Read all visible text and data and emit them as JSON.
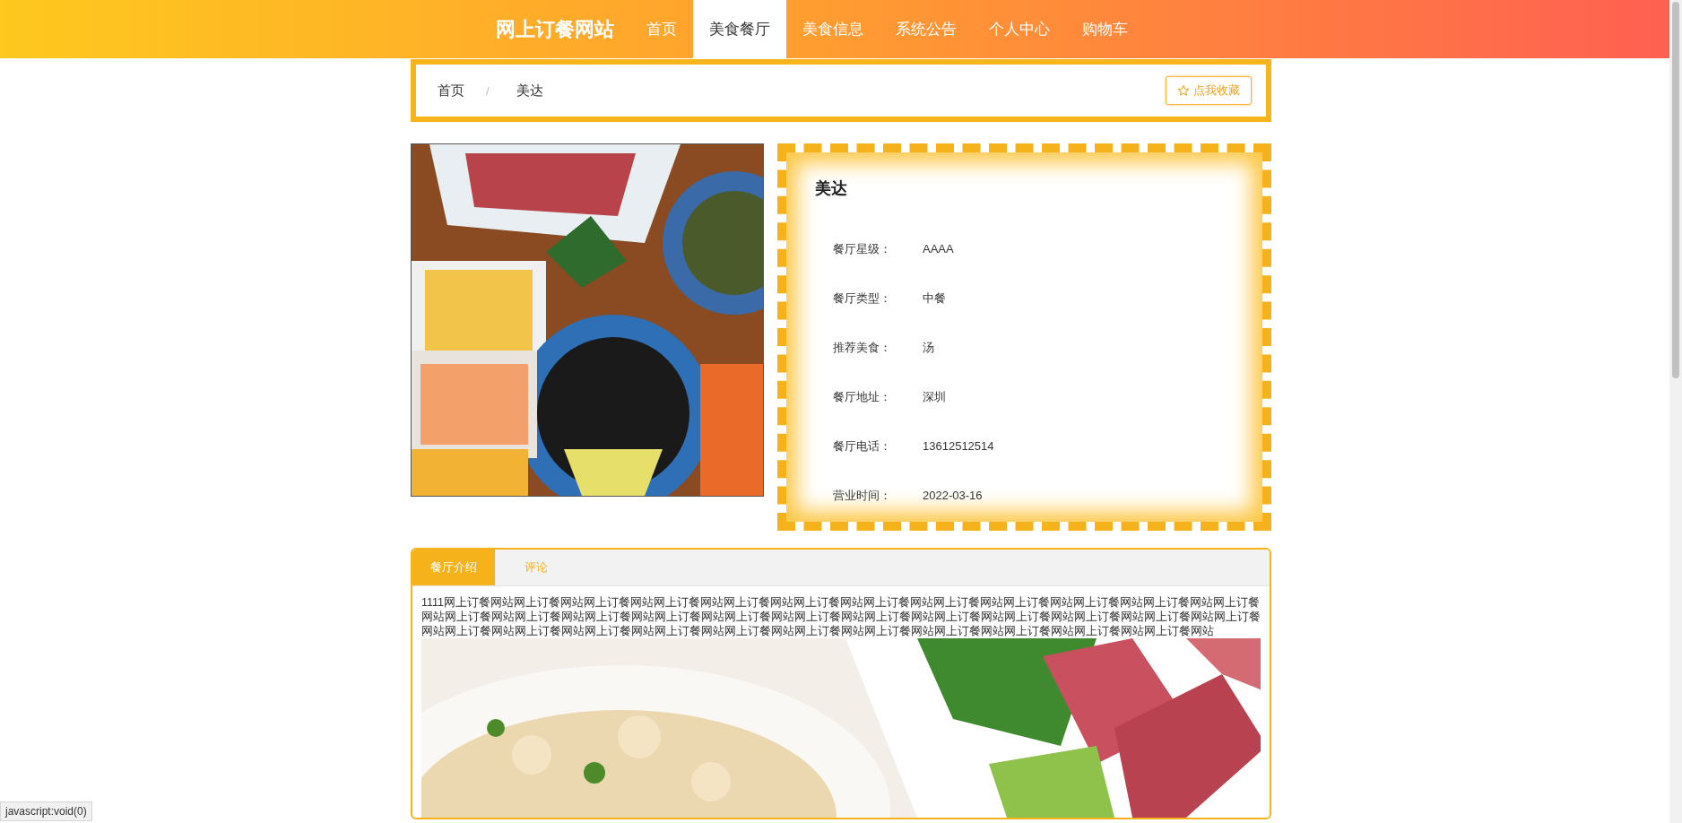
{
  "nav": {
    "brand": "网上订餐网站",
    "items": [
      {
        "label": "首页",
        "selected": false
      },
      {
        "label": "美食餐厅",
        "selected": true
      },
      {
        "label": "美食信息",
        "selected": false
      },
      {
        "label": "系统公告",
        "selected": false
      },
      {
        "label": "个人中心",
        "selected": false
      },
      {
        "label": "购物车",
        "selected": false
      }
    ]
  },
  "breadcrumb": [
    {
      "label": "首页"
    },
    {
      "label": "美达"
    }
  ],
  "breadcrumb_separator": "/",
  "favorite_button": "点我收藏",
  "restaurant": {
    "name": "美达",
    "fields": [
      {
        "label": "餐厅星级：",
        "value": "AAAA"
      },
      {
        "label": "餐厅类型：",
        "value": "中餐"
      },
      {
        "label": "推荐美食：",
        "value": "汤"
      },
      {
        "label": "餐厅地址：",
        "value": "深圳"
      },
      {
        "label": "餐厅电话：",
        "value": "13612512514"
      },
      {
        "label": "营业时间：",
        "value": "2022-03-16"
      }
    ]
  },
  "tabs": [
    {
      "label": "餐厅介绍",
      "selected": true
    },
    {
      "label": "评论",
      "selected": false
    }
  ],
  "intro": {
    "text": "1111网上订餐网站网上订餐网站网上订餐网站网上订餐网站网上订餐网站网上订餐网站网上订餐网站网上订餐网站网上订餐网站网上订餐网站网上订餐网站网上订餐网站网上订餐网站网上订餐网站网上订餐网站网上订餐网站网上订餐网站网上订餐网站网上订餐网站网上订餐网站网上订餐网站网上订餐网站网上订餐网站网上订餐网站网上订餐网站网上订餐网站网上订餐网站网上订餐网站网上订餐网站网上订餐网站网上订餐网站网上订餐网站网上订餐网站网上订餐网站网上订餐网站"
  },
  "status_tooltip": "javascript:void(0)"
}
